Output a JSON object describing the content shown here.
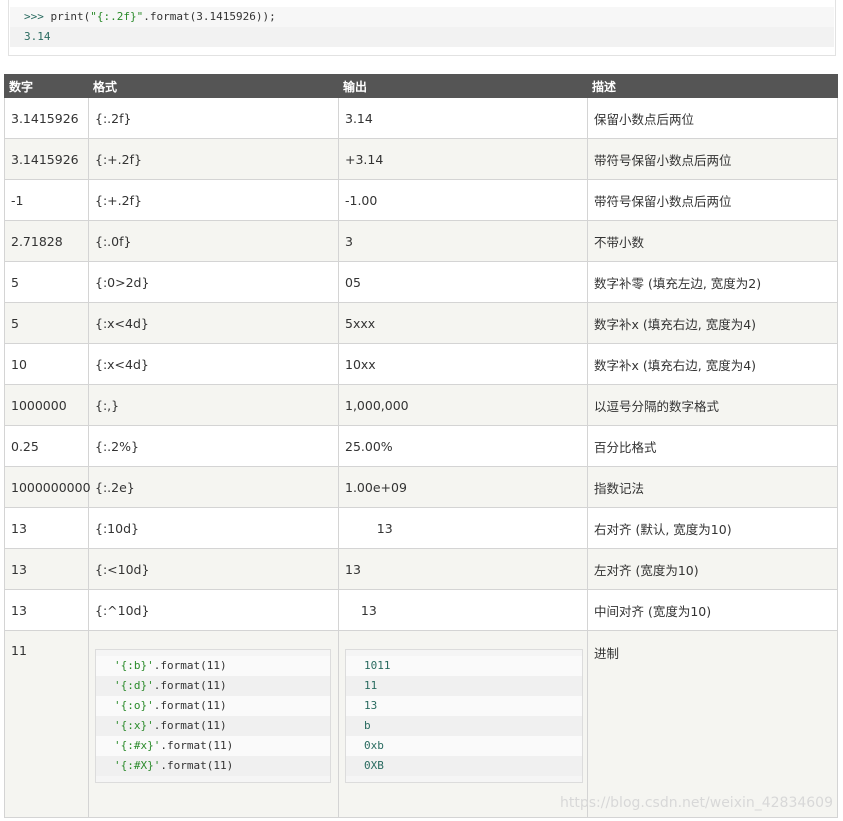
{
  "top_code": {
    "prompt": ">>> ",
    "call": "print(",
    "string": "\"{:.2f}\"",
    "rest": ".format(3.1415926));",
    "output": "3.14"
  },
  "headers": [
    "数字",
    "格式",
    "输出",
    "描述"
  ],
  "rows": [
    [
      "3.1415926",
      "{:.2f}",
      "3.14",
      "保留小数点后两位"
    ],
    [
      "3.1415926",
      "{:+.2f}",
      "+3.14",
      "带符号保留小数点后两位"
    ],
    [
      "-1",
      "{:+.2f}",
      "-1.00",
      "带符号保留小数点后两位"
    ],
    [
      "2.71828",
      "{:.0f}",
      "3",
      "不带小数"
    ],
    [
      "5",
      "{:0>2d}",
      "05",
      "数字补零 (填充左边, 宽度为2)"
    ],
    [
      "5",
      "{:x<4d}",
      "5xxx",
      "数字补x (填充右边, 宽度为4)"
    ],
    [
      "10",
      "{:x<4d}",
      "10xx",
      "数字补x (填充右边, 宽度为4)"
    ],
    [
      "1000000",
      "{:,}",
      "1,000,000",
      "以逗号分隔的数字格式"
    ],
    [
      "0.25",
      "{:.2%}",
      "25.00%",
      "百分比格式"
    ],
    [
      "1000000000",
      "{:.2e}",
      "1.00e+09",
      "指数记法"
    ],
    [
      "13",
      "{:10d}",
      "        13",
      "右对齐 (默认, 宽度为10)"
    ],
    [
      "13",
      "{:<10d}",
      "13",
      "左对齐 (宽度为10)"
    ],
    [
      "13",
      "{:^10d}",
      "    13",
      "中间对齐 (宽度为10)"
    ]
  ],
  "last_row": {
    "number": "11",
    "description": "进制",
    "code_strings": [
      "'{:b}'",
      "'{:d}'",
      "'{:o}'",
      "'{:x}'",
      "'{:#x}'",
      "'{:#X}'"
    ],
    "code_suffix": ".format(11)",
    "outputs": [
      "1011",
      "11",
      "13",
      "b",
      "0xb",
      "0XB"
    ]
  },
  "watermark": "https://blog.csdn.net/weixin_42834609"
}
